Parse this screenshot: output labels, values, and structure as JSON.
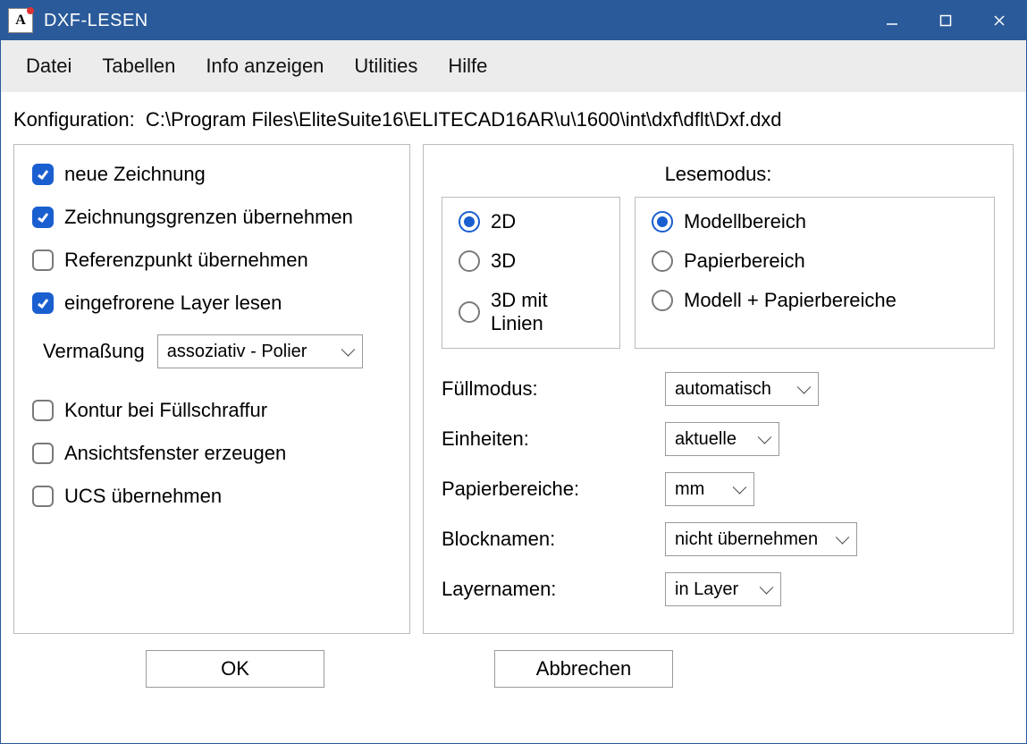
{
  "window": {
    "title": "DXF-LESEN"
  },
  "menu": {
    "items": [
      "Datei",
      "Tabellen",
      "Info anzeigen",
      "Utilities",
      "Hilfe"
    ]
  },
  "config": {
    "label": "Konfiguration:",
    "path": "C:\\Program Files\\EliteSuite16\\ELITECAD16AR\\u\\1600\\int\\dxf\\dflt\\Dxf.dxd"
  },
  "left": {
    "neue_zeichnung": "neue Zeichnung",
    "zeichnungsgrenzen": "Zeichnungsgrenzen übernehmen",
    "referenzpunkt": "Referenzpunkt übernehmen",
    "eingefrorene": "eingefrorene Layer lesen",
    "vermassung_label": "Vermaßung",
    "vermassung_value": "assoziativ - Polier",
    "kontur": "Kontur bei Füllschraffur",
    "ansichtsfenster": "Ansichtsfenster erzeugen",
    "ucs": "UCS übernehmen"
  },
  "right": {
    "lesemodus": "Lesemodus:",
    "dim_2d": "2D",
    "dim_3d": "3D",
    "dim_3d_linien": "3D mit Linien",
    "modellbereich": "Modellbereich",
    "papierbereich": "Papierbereich",
    "modell_papier": "Modell + Papierbereiche",
    "fuellmodus_label": "Füllmodus:",
    "fuellmodus_value": "automatisch",
    "einheiten_label": "Einheiten:",
    "einheiten_value": "aktuelle",
    "papierbereiche_label": "Papierbereiche:",
    "papierbereiche_value": "mm",
    "blocknamen_label": "Blocknamen:",
    "blocknamen_value": "nicht übernehmen",
    "layernamen_label": "Layernamen:",
    "layernamen_value": "in Layer"
  },
  "buttons": {
    "ok": "OK",
    "cancel": "Abbrechen"
  }
}
